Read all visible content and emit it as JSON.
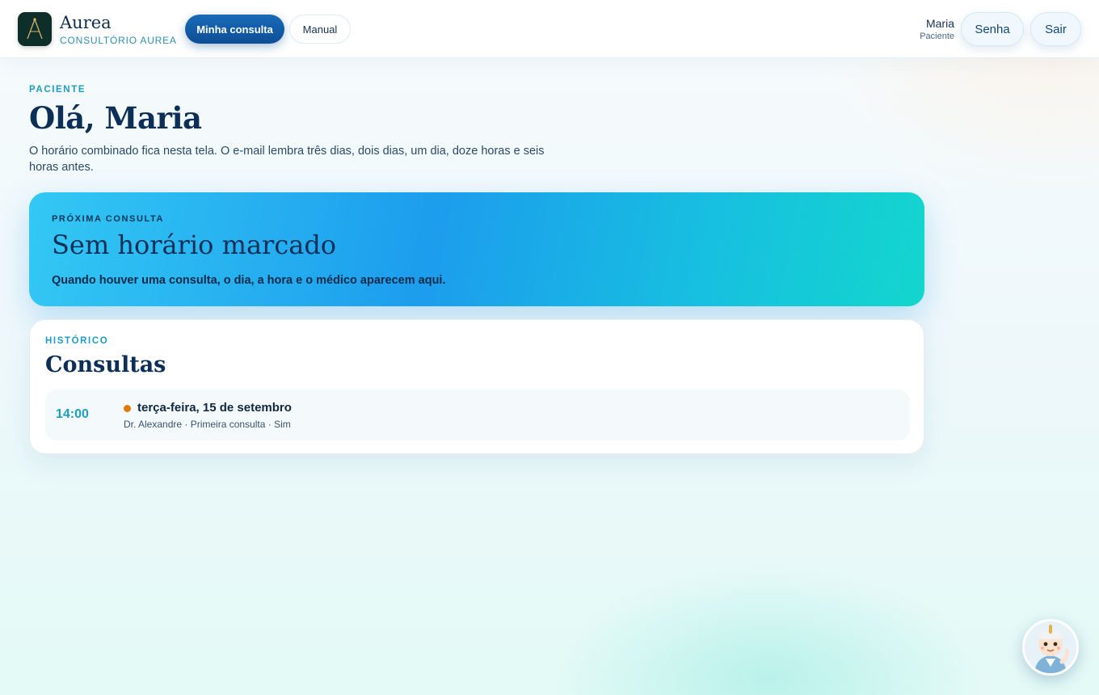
{
  "header": {
    "brand_name": "Aurea",
    "brand_subtitle": "CONSULTÓRIO AUREA",
    "nav": [
      {
        "label": "Minha consulta",
        "active": true
      },
      {
        "label": "Manual",
        "active": false
      }
    ],
    "user": {
      "name": "Maria",
      "role": "Paciente"
    },
    "actions": {
      "password": "Senha",
      "logout": "Sair"
    }
  },
  "main": {
    "eyebrow": "PACIENTE",
    "greeting": "Olá, Maria",
    "intro": "O horário combinado fica nesta tela. O e-mail lembra três dias, dois dias, um dia, doze horas e seis horas antes."
  },
  "next_appointment": {
    "eyebrow": "PRÓXIMA CONSULTA",
    "title": "Sem horário marcado",
    "description": "Quando houver uma consulta, o dia, a hora e o médico aparecem aqui."
  },
  "history": {
    "eyebrow": "HISTÓRICO",
    "title": "Consultas",
    "items": [
      {
        "time": "14:00",
        "date": "terça-feira, 15 de setembro",
        "details": "Dr. Alexandre · Primeira consulta · Sim",
        "status_color": "#e07b0b"
      }
    ]
  },
  "assistant": {
    "icon": "doctor-mascot-icon"
  },
  "colors": {
    "accent": "#1a9ec2",
    "primary": "#0d4f95",
    "heading": "#0c2f57",
    "card_gradient_start": "#33c8f4",
    "card_gradient_end": "#13d6cd"
  }
}
